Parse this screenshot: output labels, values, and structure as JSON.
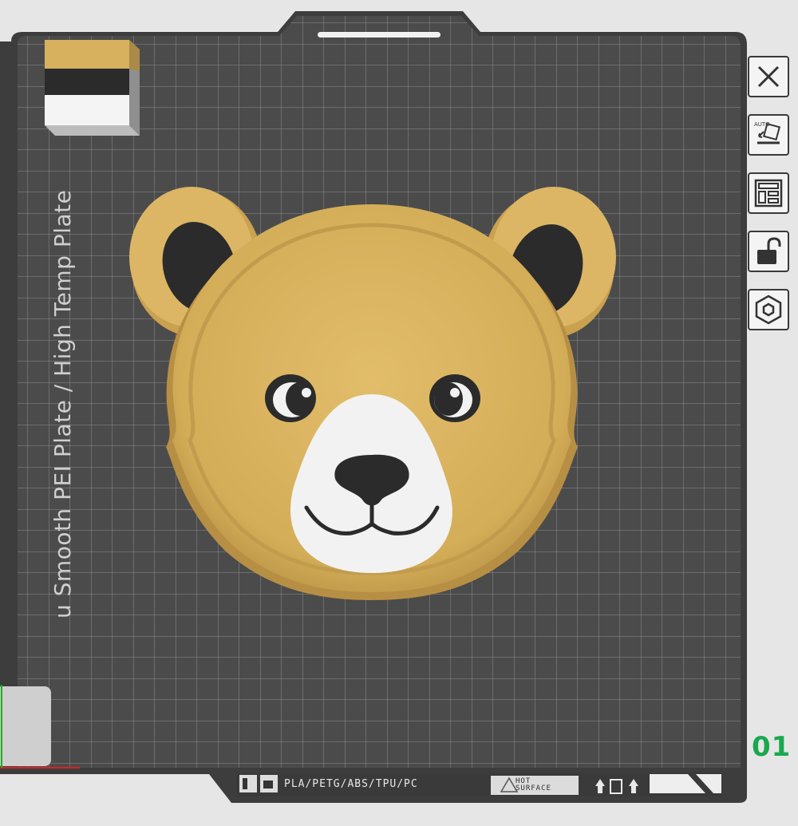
{
  "plate": {
    "label": "Textured / Smooth PEI Plate / High Temp Plate",
    "visible_label": "u Smooth PEI Plate / High Temp Plate",
    "number": "01",
    "number_color": "#1aa84f",
    "bed_color": "#4b4b4b",
    "grid_color": "#8a8a8a"
  },
  "bed_strip": {
    "materials": "PLA/PETG/ABS/TPU/PC",
    "hot_line1": "HOT",
    "hot_line2": "SURFACE"
  },
  "filament_colors": [
    "#d8b15f",
    "#2b2b2b",
    "#f4f4f4"
  ],
  "model": {
    "name": "bear-face-tray",
    "body_color": "#d9b35e",
    "dark_color": "#2b2b2b",
    "white_color": "#f2f2f2"
  },
  "toolbar": [
    {
      "name": "close",
      "icon": "close-icon"
    },
    {
      "name": "auto-orient",
      "icon": "auto-orient-icon",
      "text": "AUTO"
    },
    {
      "name": "arrange",
      "icon": "arrange-icon"
    },
    {
      "name": "lock",
      "icon": "lock-icon"
    },
    {
      "name": "plate-settings",
      "icon": "hexagon-nut-icon"
    }
  ]
}
